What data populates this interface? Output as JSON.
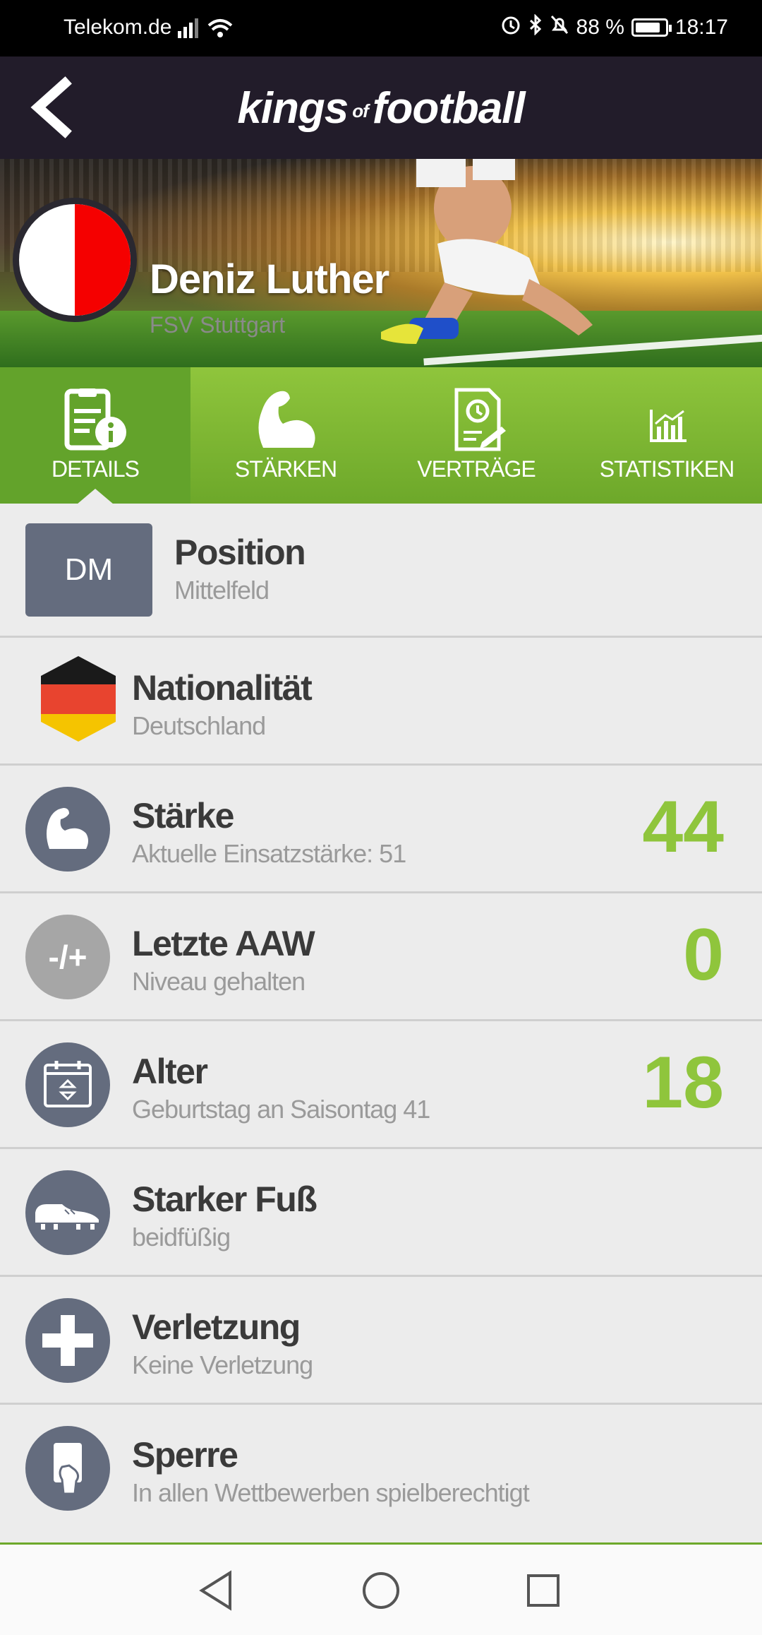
{
  "status_bar": {
    "carrier": "Telekom.de",
    "battery": "88 %",
    "battery_level": 0.88,
    "time": "18:17"
  },
  "header": {
    "logo_kings": "kings",
    "logo_of": "of",
    "logo_football": "football"
  },
  "player": {
    "name": "Deniz Luther",
    "club": "FSV Stuttgart"
  },
  "tabs": [
    {
      "label": "DETAILS",
      "icon": "document-info-icon",
      "active": true
    },
    {
      "label": "STÄRKEN",
      "icon": "flexed-arm-icon",
      "active": false
    },
    {
      "label": "VERTRÄGE",
      "icon": "contract-icon",
      "active": false
    },
    {
      "label": "STATISTIKEN",
      "icon": "bar-chart-icon",
      "active": false
    }
  ],
  "details": {
    "position": {
      "badge": "DM",
      "title": "Position",
      "sub": "Mittelfeld"
    },
    "nationality": {
      "title": "Nationalität",
      "sub": "Deutschland"
    },
    "strength": {
      "title": "Stärke",
      "sub": "Aktuelle Einsatzstärke: 51",
      "value": "44"
    },
    "last_aaw": {
      "icon_text": "-/+",
      "title": "Letzte AAW",
      "sub": "Niveau gehalten",
      "value": "0"
    },
    "age": {
      "title": "Alter",
      "sub": "Geburtstag an Saisontag 41",
      "value": "18"
    },
    "foot": {
      "title": "Starker Fuß",
      "sub": "beidfüßig"
    },
    "injury": {
      "title": "Verletzung",
      "sub": "Keine Verletzung"
    },
    "suspension": {
      "title": "Sperre",
      "sub": "In allen Wettbewerben spielberechtigt"
    }
  },
  "colors": {
    "accent_green": "#8fc53c",
    "header_dark": "#221c2a",
    "icon_slate": "#646c7e"
  }
}
